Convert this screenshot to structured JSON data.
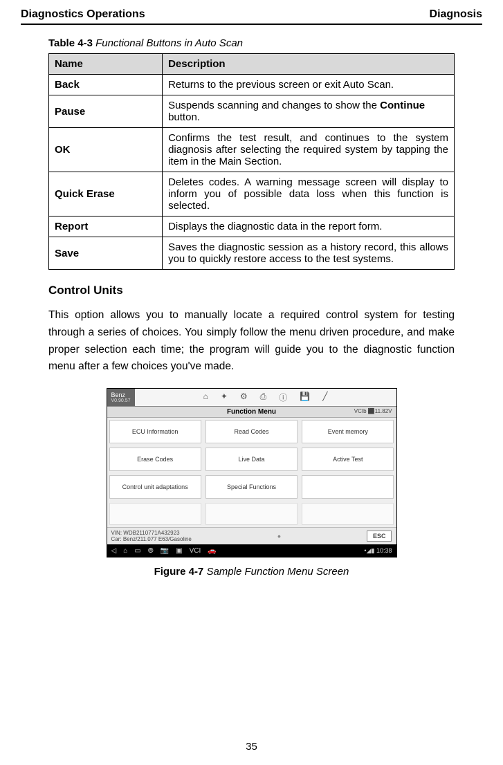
{
  "header": {
    "left": "Diagnostics Operations",
    "right": "Diagnosis"
  },
  "table_caption": {
    "bold": "Table 4-3",
    "italic": " Functional Buttons in Auto Scan"
  },
  "table": {
    "head": {
      "name": "Name",
      "desc": "Description"
    },
    "rows": [
      {
        "name": "Back",
        "desc": "Returns to the previous screen or exit Auto Scan."
      },
      {
        "name": "Pause",
        "desc_pre": "Suspends scanning and changes to show the ",
        "desc_bold": "Continue",
        "desc_post": " button."
      },
      {
        "name": "OK",
        "desc": "Confirms the test result, and continues to the system diagnosis after selecting the required system by tapping the item in the Main Section."
      },
      {
        "name": "Quick Erase",
        "desc": "Deletes codes. A warning message screen will display to inform you of possible data loss when this function is selected."
      },
      {
        "name": "Report",
        "desc": "Displays the diagnostic data in the report form."
      },
      {
        "name": "Save",
        "desc": "Saves the diagnostic session as a history record, this allows you to quickly restore access to the test systems."
      }
    ]
  },
  "section_title": "Control Units",
  "paragraph": "This option allows you to manually locate a required control system for testing through a series of choices. You simply follow the menu driven procedure, and make proper selection each time; the program will guide you to the diagnostic function menu after a few choices you've made.",
  "figure": {
    "brand": "Benz",
    "version": "V0.90.57",
    "titlebar": "Function Menu",
    "vci": "VCIb  ⬛11.82V",
    "menu": [
      "ECU Information",
      "Read Codes",
      "Event memory",
      "Erase Codes",
      "Live Data",
      "Active Test",
      "Control unit adaptations",
      "Special Functions",
      ""
    ],
    "vin_line": "VIN: WDB2110771A432923",
    "car_line": "Car: Benz/211.077 E63/Gasoline",
    "esc": "ESC",
    "time": "10:38"
  },
  "figure_caption": {
    "bold": "Figure 4-7",
    "italic": " Sample Function Menu Screen"
  },
  "page_number": "35"
}
